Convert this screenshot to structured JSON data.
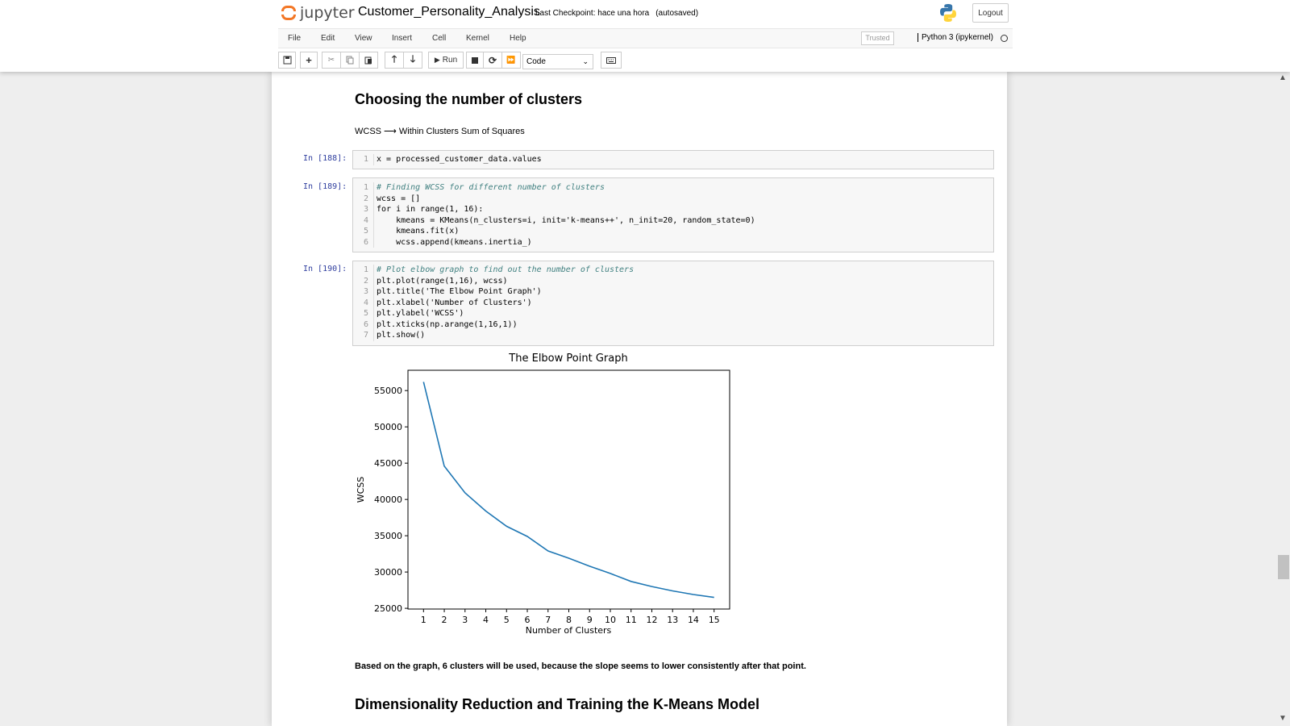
{
  "header": {
    "logo_text": "jupyter",
    "notebook_title": "Customer_Personality_Analysis",
    "checkpoint": "Last Checkpoint: hace una hora",
    "autosave": "(autosaved)",
    "logout": "Logout"
  },
  "menu": [
    "File",
    "Edit",
    "View",
    "Insert",
    "Cell",
    "Kernel",
    "Help"
  ],
  "status": {
    "trusted": "Trusted",
    "kernel": "Python 3 (ipykernel)"
  },
  "toolbar": {
    "run_label": "Run",
    "cell_type": "Code"
  },
  "notebook": {
    "heading1": "Choosing the number of clusters",
    "wcss_text": "WCSS ⟶ Within Clusters Sum of Squares",
    "cells": [
      {
        "prompt": "In [188]:",
        "lines": [
          "x = processed_customer_data.values"
        ]
      },
      {
        "prompt": "In [189]:",
        "lines": [
          "# Finding WCSS for different number of clusters",
          "wcss = []",
          "for i in range(1, 16):",
          "    kmeans = KMeans(n_clusters=i, init='k-means++', n_init=20, random_state=0)",
          "    kmeans.fit(x)",
          "    wcss.append(kmeans.inertia_)"
        ]
      },
      {
        "prompt": "In [190]:",
        "lines": [
          "# Plot elbow graph to find out the number of clusters",
          "plt.plot(range(1,16), wcss)",
          "plt.title('The Elbow Point Graph')",
          "plt.xlabel('Number of Clusters')",
          "plt.ylabel('WCSS')",
          "plt.xticks(np.arange(1,16,1))",
          "plt.show()"
        ]
      }
    ],
    "conclusion": "Based on the graph, 6 clusters will be used, because the slope seems to lower consistently after that point.",
    "heading2": "Dimensionality Reduction and Training the K-Means Model"
  },
  "chart_data": {
    "type": "line",
    "title": "The Elbow Point Graph",
    "xlabel": "Number of Clusters",
    "ylabel": "WCSS",
    "x": [
      1,
      2,
      3,
      4,
      5,
      6,
      7,
      8,
      9,
      10,
      11,
      12,
      13,
      14,
      15
    ],
    "y": [
      56200,
      44600,
      40900,
      38400,
      36300,
      34900,
      32900,
      31900,
      30800,
      29800,
      28700,
      28000,
      27400,
      26900,
      26500
    ],
    "yticks": [
      25000,
      30000,
      35000,
      40000,
      45000,
      50000,
      55000
    ],
    "xlim": [
      0.25,
      15.75
    ],
    "ylim": [
      24900,
      57800
    ],
    "line_color": "#1f77b4",
    "grid": false
  }
}
